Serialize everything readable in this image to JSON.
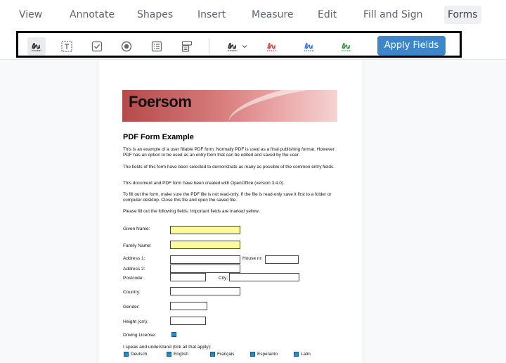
{
  "menu": {
    "items": [
      "View",
      "Annotate",
      "Shapes",
      "Insert",
      "Measure",
      "Edit",
      "Fill and Sign",
      "Forms"
    ],
    "active": "Forms"
  },
  "toolbar": {
    "tools": [
      "signature-field-icon",
      "text-field-icon",
      "checkbox-field-icon",
      "radio-field-icon",
      "list-field-icon",
      "dropdown-field-icon"
    ],
    "signature_colors": [
      "#222222",
      "#e53935",
      "#3a6fd8",
      "#2e9b3a"
    ],
    "apply_label": "Apply Fields",
    "accent": "#3c86c9"
  },
  "document": {
    "banner_title": "Foersom",
    "title": "PDF Form Example",
    "paragraphs": [
      "This is an example of a user fillable PDF form. Normally PDF is used as a final publishing format. However PDF has an option to be used as an entry form that can be edited and saved by the user.",
      "The fields of this form have been selected to demonstrate as many as possible of the common entry fields.",
      "This document and PDF form have been created with OpenOffice (version 3.4.0).",
      "To fill out the form, make sure the PDF file is not read-only. If the file is read-only save it first to a folder or computer desktop. Close this file and open the saved file.",
      "Please fill out the following fields. Important fields are marked yellow."
    ],
    "labels": {
      "given_name": "Given Name:",
      "family_name": "Family Name:",
      "address1": "Address 1:",
      "house_nr": "House nr:",
      "address2": "Address 2:",
      "postcode": "Postcode:",
      "city": "City:",
      "country": "Country:",
      "gender": "Gender:",
      "height": "Height (cm):",
      "driving_license": "Driving License:",
      "languages_prompt": "I speak and understand (tick all that apply):"
    },
    "languages": [
      "Deutsch",
      "English",
      "Français",
      "Esperanto",
      "Latin"
    ]
  }
}
